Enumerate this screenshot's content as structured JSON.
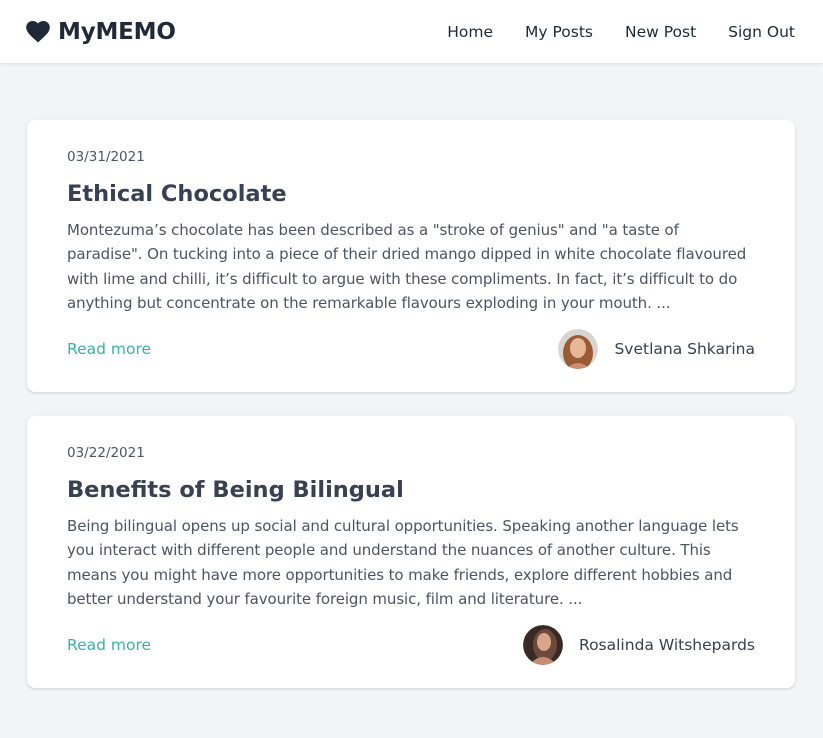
{
  "header": {
    "brand": "MyMEMO",
    "nav": [
      "Home",
      "My Posts",
      "New Post",
      "Sign Out"
    ]
  },
  "posts": [
    {
      "date": "03/31/2021",
      "title": "Ethical Chocolate",
      "excerpt": "Montezuma’s chocolate has been described as a \"stroke of genius\" and \"a taste of paradise\". On tucking into a piece of their dried mango dipped in white chocolate flavoured with lime and chilli, it’s difficult to argue with these compliments. In fact, it’s difficult to do anything but concentrate on the remarkable flavours exploding in your mouth. ...",
      "read_more": "Read more",
      "author": "Svetlana Shkarina"
    },
    {
      "date": "03/22/2021",
      "title": "Benefits of Being Bilingual",
      "excerpt": "Being bilingual opens up social and cultural opportunities. Speaking another language lets you interact with different people and understand the nuances of another culture. This means you might have more opportunities to make friends, explore different hobbies and better understand your favourite foreign music, film and literature. ...",
      "read_more": "Read more",
      "author": "Rosalinda Witshepards"
    }
  ],
  "colors": {
    "accent": "#38b2ac",
    "background": "#f3f4f6",
    "text": "#374151"
  }
}
